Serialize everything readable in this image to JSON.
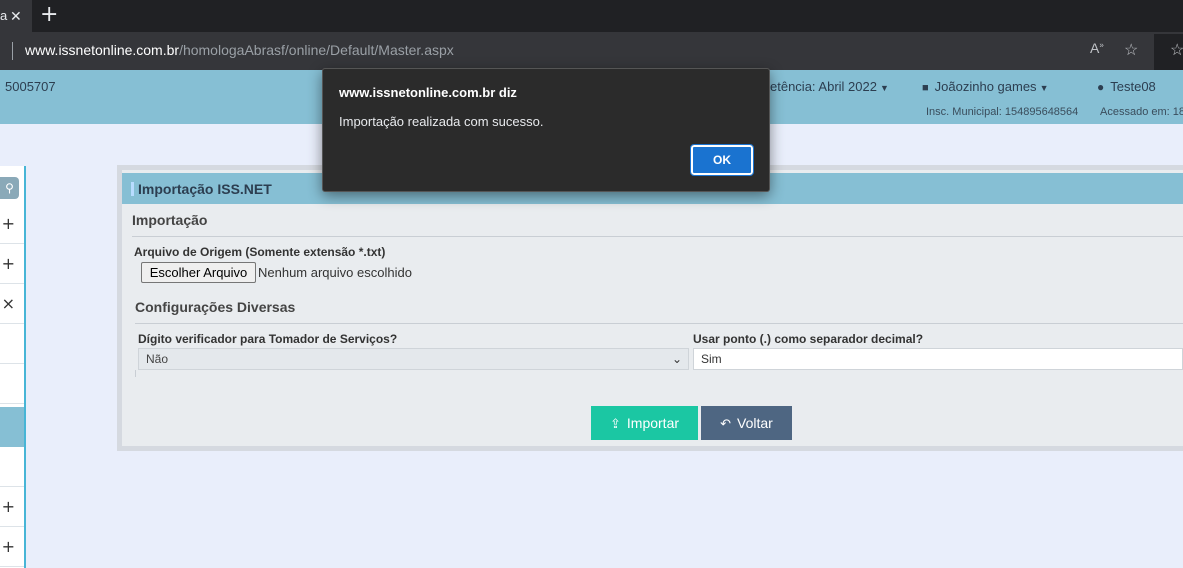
{
  "browser": {
    "tab_label": "a",
    "tab_close": "✕",
    "new_tab": "+",
    "url_host": "www.issnetonline.com.br",
    "url_path": "/homologaAbrasf/online/Default/Master.aspx",
    "read_aloud": "A͆",
    "favorites_add": "☆",
    "favorites": "☆"
  },
  "header": {
    "code": "5005707",
    "competencia": "etência: Abril 2022",
    "company": "Joãozinho games",
    "user": "Teste08",
    "insc_municipal": "Insc. Municipal: 154895648564",
    "acessado": "Acessado em: 18"
  },
  "sidebar": {
    "search_icon": "⚲",
    "rows": [
      "+",
      "+",
      "×",
      "",
      "",
      "",
      "",
      "+",
      "+"
    ]
  },
  "panel": {
    "title": "Importação ISS.NET",
    "section_import": "Importação",
    "file_label": "Arquivo de Origem (Somente extensão *.txt)",
    "file_button": "Escolher Arquivo",
    "file_none": "Nenhum arquivo escolhido",
    "section_config": "Configurações Diversas",
    "digito_label": "Dígito verificador para Tomador de Serviços?",
    "digito_value": "Não",
    "ponto_label": "Usar ponto (.) como separador decimal?",
    "ponto_value": "Sim",
    "import_button": "Importar",
    "back_button": "Voltar"
  },
  "dialog": {
    "title": "www.issnetonline.com.br diz",
    "message": "Importação realizada com sucesso.",
    "ok": "OK"
  },
  "colors": {
    "header_bg": "#86bfd4",
    "import_btn": "#1bc7a3",
    "back_btn": "#4e6682",
    "dialog_ok": "#1a73d0"
  }
}
